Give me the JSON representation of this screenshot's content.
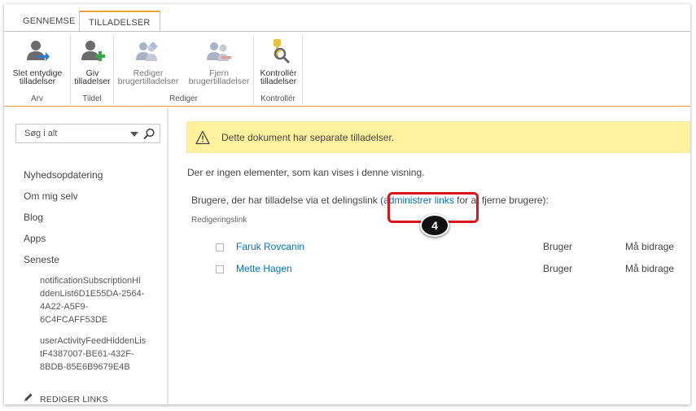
{
  "tabs": [
    {
      "label": "GENNEMSE",
      "active": false
    },
    {
      "label": "TILLADELSER",
      "active": true
    }
  ],
  "ribbon": {
    "groups": [
      {
        "label": "Arv",
        "buttons": [
          {
            "label_lines": [
              "Slet entydige",
              "tilladelser"
            ],
            "icon": "user-arrow-icon",
            "enabled": true
          }
        ]
      },
      {
        "label": "Tildel",
        "buttons": [
          {
            "label_lines": [
              "Giv",
              "tilladelser"
            ],
            "icon": "user-plus-icon",
            "enabled": true
          }
        ]
      },
      {
        "label": "Rediger",
        "buttons": [
          {
            "label_lines": [
              "Rediger",
              "brugertilladelser"
            ],
            "icon": "users-edit-icon",
            "enabled": false
          },
          {
            "label_lines": [
              "Fjern",
              "brugertilladelser"
            ],
            "icon": "users-remove-icon",
            "enabled": false
          }
        ]
      },
      {
        "label": "Kontrollér",
        "buttons": [
          {
            "label_lines": [
              "Kontrollér",
              "tilladelser"
            ],
            "icon": "key-magnifier-icon",
            "enabled": true
          }
        ]
      }
    ]
  },
  "search": {
    "placeholder": "Søg i alt"
  },
  "nav": {
    "items": [
      "Nyhedsopdatering",
      "Om mig selv",
      "Blog",
      "Apps",
      "Seneste"
    ],
    "recent": [
      [
        "notificationSubscriptionHi",
        "ddenList6D1E55DA-2564-",
        "4A22-A5F9-",
        "6C4FCAFF53DE"
      ],
      [
        "userActivityFeedHiddenLis",
        "tF4387007-BE61-432F-",
        "8BDB-85E6B9679E4B"
      ]
    ],
    "edit_links": "REDIGER LINKS"
  },
  "main": {
    "banner": "Dette dokument har separate tilladelser.",
    "no_items": "Der er ingen elementer, som kan vises i denne visning.",
    "users_prefix": "Brugere, der har tilladelse via et delingslink (",
    "users_link": "administrer links",
    "users_suffix": " for at fjerne brugere):",
    "edit_link_header": "Redigeringslink",
    "users": [
      {
        "name": "Faruk Rovcanin",
        "role": "Bruger",
        "permission": "Må bidrage"
      },
      {
        "name": "Mette Hagen",
        "role": "Bruger",
        "permission": "Må bidrage"
      }
    ]
  },
  "callout": {
    "number": "4",
    "color": "#d9141b"
  },
  "colors": {
    "accent": "#e8a33b",
    "link": "#0072c6",
    "banner": "#fff19d"
  }
}
